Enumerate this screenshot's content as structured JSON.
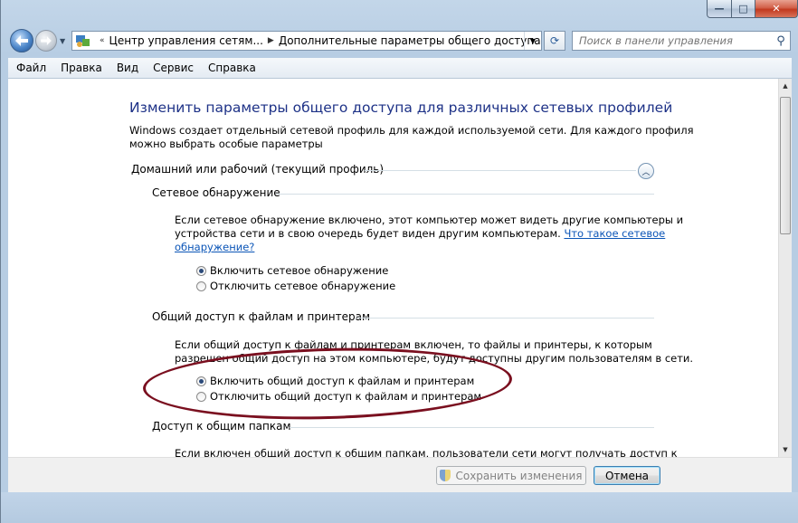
{
  "window": {
    "min": "—",
    "max": "□",
    "close": "✕"
  },
  "address": {
    "crumbs": [
      "Центр управления сетям...",
      "Дополнительные параметры общего доступа"
    ],
    "lead": "«"
  },
  "search": {
    "placeholder": "Поиск в панели управления"
  },
  "menu": [
    "Файл",
    "Правка",
    "Вид",
    "Сервис",
    "Справка"
  ],
  "content": {
    "title": "Изменить параметры общего доступа для различных сетевых профилей",
    "intro_line1": "Windows создает отдельный сетевой профиль для каждой используемой сети. Для каждого профиля",
    "intro_line2": "можно выбрать особые параметры",
    "profile": "Домашний или рабочий (текущий профиль)",
    "discovery": {
      "heading": "Сетевое обнаружение",
      "desc_line1": "Если сетевое обнаружение включено, этот компьютер может видеть другие компьютеры и",
      "desc_line2": "устройства сети и в свою очередь будет виден другим компьютерам.",
      "link_part1": "Что такое сетевое",
      "link_part2": "обнаружение?",
      "opt_on": "Включить сетевое обнаружение",
      "opt_off": "Отключить сетевое обнаружение"
    },
    "sharing": {
      "heading": "Общий доступ к файлам и принтерам",
      "desc_line1": "Если общий доступ к файлам и принтерам включен, то файлы и принтеры, к которым",
      "desc_line2": "разрешен общий доступ на этом компьютере, будут доступны другим пользователям в сети.",
      "opt_on": "Включить общий доступ к файлам и принтерам",
      "opt_off": "Отключить общий доступ к файлам и принтерам"
    },
    "folders": {
      "heading": "Доступ к общим папкам",
      "desc_line1": "Если включен общий доступ к общим папкам, пользователи сети могут получать доступ к"
    }
  },
  "footer": {
    "save": "Сохранить изменения",
    "cancel": "Отмена"
  }
}
